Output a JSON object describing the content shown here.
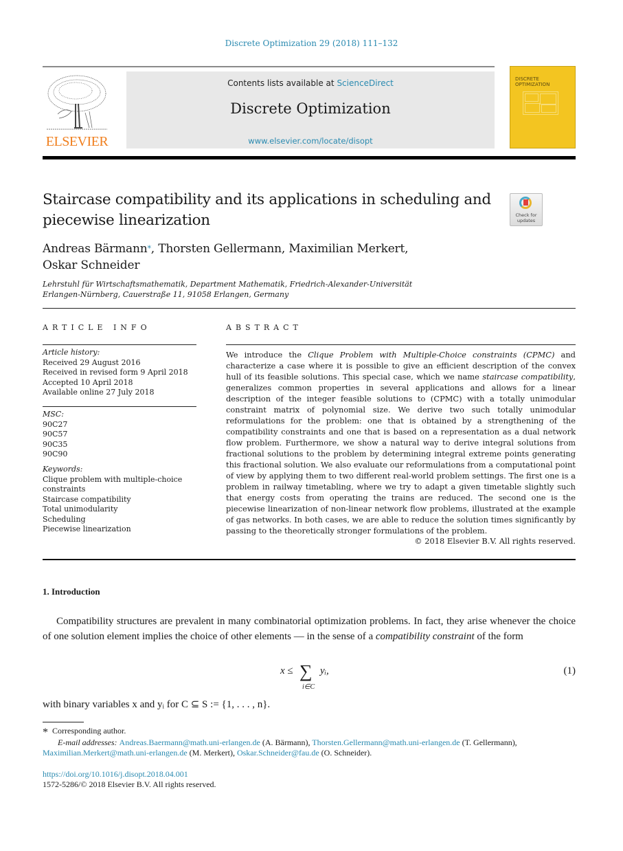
{
  "header": {
    "journal_reference": "Discrete Optimization 29 (2018) 111–132",
    "contents_prefix": "Contents lists available at ",
    "contents_link": "ScienceDirect",
    "journal_title": "Discrete Optimization",
    "journal_url": "www.elsevier.com/locate/disopt",
    "publisher_logo_text": "ELSEVIER",
    "cover_title_line1": "DISCRETE",
    "cover_title_line2": "OPTIMIZATION",
    "brand_color": "#f07f1e",
    "link_color": "#2a8ab0",
    "cover_color": "#f3c521"
  },
  "article": {
    "title": "Staircase compatibility and its applications in scheduling and piecewise linearization",
    "check_updates_label": "Check for updates",
    "authors": [
      {
        "name": "Andreas Bärmann",
        "corresponding": true
      },
      {
        "name": "Thorsten Gellermann",
        "corresponding": false
      },
      {
        "name": "Maximilian Merkert",
        "corresponding": false
      },
      {
        "name": "Oskar Schneider",
        "corresponding": false
      }
    ],
    "author_star": "*",
    "affiliation_line1": "Lehrstuhl für Wirtschaftsmathematik, Department Mathematik, Friedrich-Alexander-Universität",
    "affiliation_line2": "Erlangen-Nürnberg, Cauerstraße 11, 91058 Erlangen, Germany"
  },
  "article_info": {
    "heading": "ARTICLE INFO",
    "history_label": "Article history:",
    "history": [
      "Received 29 August 2016",
      "Received in revised form 9 April 2018",
      "Accepted 10 April 2018",
      "Available online 27 July 2018"
    ],
    "msc_label": "MSC:",
    "msc": [
      "90C27",
      "90C57",
      "90C35",
      "90C90"
    ],
    "keywords_label": "Keywords:",
    "keywords": [
      "Clique problem with multiple-choice constraints",
      "Staircase compatibility",
      "Total unimodularity",
      "Scheduling",
      "Piecewise linearization"
    ]
  },
  "abstract": {
    "heading": "ABSTRACT",
    "p1_start": "We introduce the ",
    "p1_em1": "Clique Problem with Multiple-Choice constraints (CPMC)",
    "p1_mid": " and characterize a case where it is possible to give an efficient description of the convex hull of its feasible solutions. This special case, which we name ",
    "p1_em2": "staircase compatibility",
    "p1_end": ", generalizes common properties in several applications and allows for a linear description of the integer feasible solutions to (CPMC) with a totally unimodular constraint matrix of polynomial size. We derive two such totally unimodular reformulations for the problem: one that is obtained by a strengthening of the compatibility constraints and one that is based on a representation as a dual network flow problem. Furthermore, we show a natural way to derive integral solutions from fractional solutions to the problem by determining integral extreme points generating this fractional solution. We also evaluate our reformulations from a computational point of view by applying them to two different real-world problem settings. The first one is a problem in railway timetabling, where we try to adapt a given timetable slightly such that energy costs from operating the trains are reduced. The second one is the piecewise linearization of non-linear network flow problems, illustrated at the example of gas networks. In both cases, we are able to reduce the solution times significantly by passing to the theoretically stronger formulations of the problem.",
    "copyright": "© 2018 Elsevier B.V. All rights reserved."
  },
  "introduction": {
    "heading": "1.  Introduction",
    "p1_start": "Compatibility structures are prevalent in many combinatorial optimization problems. In fact, they arise whenever the choice of one solution element implies the choice of other elements — in the sense of a ",
    "p1_em": "compatibility constraint",
    "p1_end": " of the form",
    "equation_lhs": "x ≤",
    "equation_sum": "∑",
    "equation_sub": "i∈C",
    "equation_rhs": "yᵢ,",
    "equation_number": "(1)",
    "after_equation": "with binary variables x and yᵢ for C ⊆ S := {1, . . . , n}."
  },
  "footnotes": {
    "star": "*",
    "corresponding": "Corresponding author.",
    "email_label": "E-mail addresses: ",
    "emails": [
      {
        "address": "Andreas.Baermann@math.uni-erlangen.de",
        "owner": " (A. Bärmann), "
      },
      {
        "address": "Thorsten.Gellermann@math.uni-erlangen.de",
        "owner": " (T. Gellermann), "
      },
      {
        "address": "Maximilian.Merkert@math.uni-erlangen.de",
        "owner": " (M. Merkert), "
      },
      {
        "address": "Oskar.Schneider@fau.de",
        "owner": " (O. Schneider)."
      }
    ],
    "doi": "https://doi.org/10.1016/j.disopt.2018.04.001",
    "issn": "1572-5286/© 2018 Elsevier B.V. All rights reserved."
  }
}
